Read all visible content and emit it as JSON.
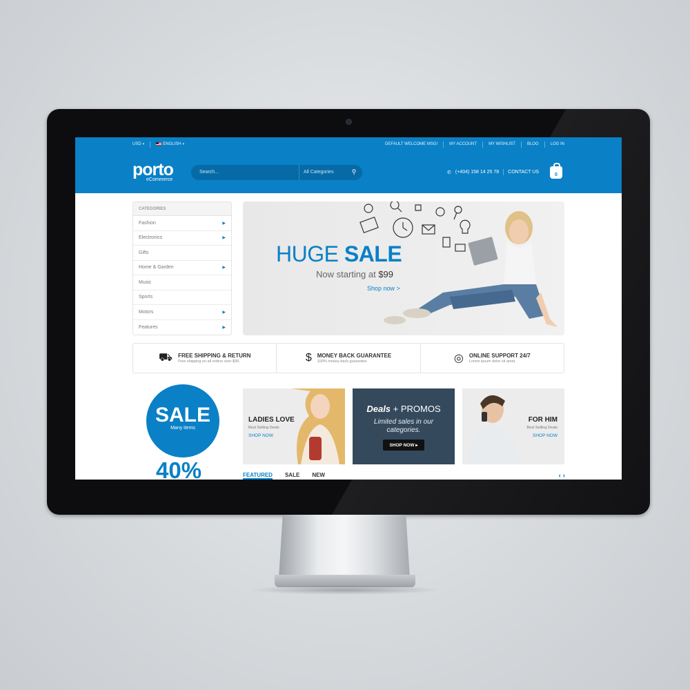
{
  "topbar": {
    "currency": "USD",
    "language": "ENGLISH",
    "links": [
      "DEFAULT WELCOME MSG!",
      "MY ACCOUNT",
      "MY WISHLIST",
      "BLOG",
      "LOG IN"
    ]
  },
  "header": {
    "logo": "porto",
    "logo_sub": "eCommerce",
    "search_placeholder": "Search...",
    "search_category": "All Categories",
    "phone": "(+404) 158 14 25 78",
    "contact": "CONTACT US",
    "cart_count": "0"
  },
  "categories": {
    "title": "CATEGORIES",
    "items": [
      {
        "label": "Fashion",
        "arrow": true
      },
      {
        "label": "Electronics",
        "arrow": true
      },
      {
        "label": "Gifts",
        "arrow": false
      },
      {
        "label": "Home & Garden",
        "arrow": true
      },
      {
        "label": "Music",
        "arrow": false
      },
      {
        "label": "Sports",
        "arrow": false
      },
      {
        "label": "Motors",
        "arrow": true
      },
      {
        "label": "Features",
        "arrow": true
      }
    ]
  },
  "hero": {
    "title_a": "HUGE ",
    "title_b": "SALE",
    "sub_a": "Now starting at ",
    "sub_b": "$99",
    "link": "Shop now >"
  },
  "features": [
    {
      "icon": "truck-icon",
      "title": "FREE SHIPPING & RETURN",
      "desc": "Free shipping on all orders over $99."
    },
    {
      "icon": "dollar-icon",
      "title": "MONEY BACK GUARANTEE",
      "desc": "100% money back guarantee."
    },
    {
      "icon": "lifebuoy-icon",
      "title": "ONLINE SUPPORT 24/7",
      "desc": "Lorem ipsum dolor sit amet."
    }
  ],
  "sale": {
    "big": "SALE",
    "small": "Many items",
    "percent": "40%"
  },
  "banners": {
    "ladies": {
      "title": "LADIES LOVE",
      "sub": "Best Selling Deals",
      "link": "SHOP NOW"
    },
    "deals": {
      "title_a": "Deals",
      "title_b": " + PROMOS",
      "text": "Limited sales in our categories.",
      "button": "SHOP NOW"
    },
    "him": {
      "title": "FOR HIM",
      "sub": "Best Selling Deals",
      "link": "SHOP NOW"
    }
  },
  "tabs": [
    "FEATURED",
    "SALE",
    "NEW"
  ],
  "colors": {
    "accent": "#0a80c6",
    "dark_banner": "#34495c"
  }
}
